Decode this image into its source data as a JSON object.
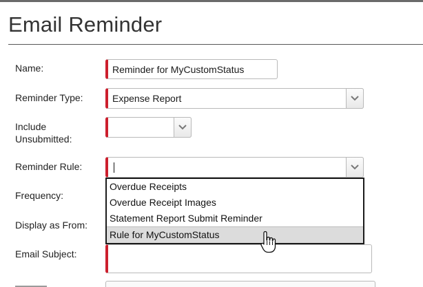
{
  "page": {
    "title": "Email Reminder"
  },
  "form": {
    "name": {
      "label": "Name:",
      "value": "Reminder for MyCustomStatus"
    },
    "reminder_type": {
      "label": "Reminder Type:",
      "value": "Expense Report"
    },
    "include_unsubmitted": {
      "label_line1": "Include",
      "label_line2": "Unsubmitted:",
      "value": ""
    },
    "reminder_rule": {
      "label": "Reminder Rule:",
      "value": "",
      "options": [
        "Overdue Receipts",
        "Overdue Receipt Images",
        "Statement Report Submit Reminder",
        "Rule for MyCustomStatus"
      ],
      "hovered_option": "Rule for MyCustomStatus"
    },
    "frequency": {
      "label": "Frequency:"
    },
    "display_as_from": {
      "label": "Display as From:"
    },
    "email_subject": {
      "label": "Email Subject:",
      "value": ""
    }
  },
  "icons": {
    "dropdown": "chevron-down-icon",
    "cursor": "hand-pointer-icon"
  },
  "colors": {
    "required_marker": "#cc1f2d",
    "title_text": "#333333",
    "hover_row": "#dcdcdc"
  }
}
